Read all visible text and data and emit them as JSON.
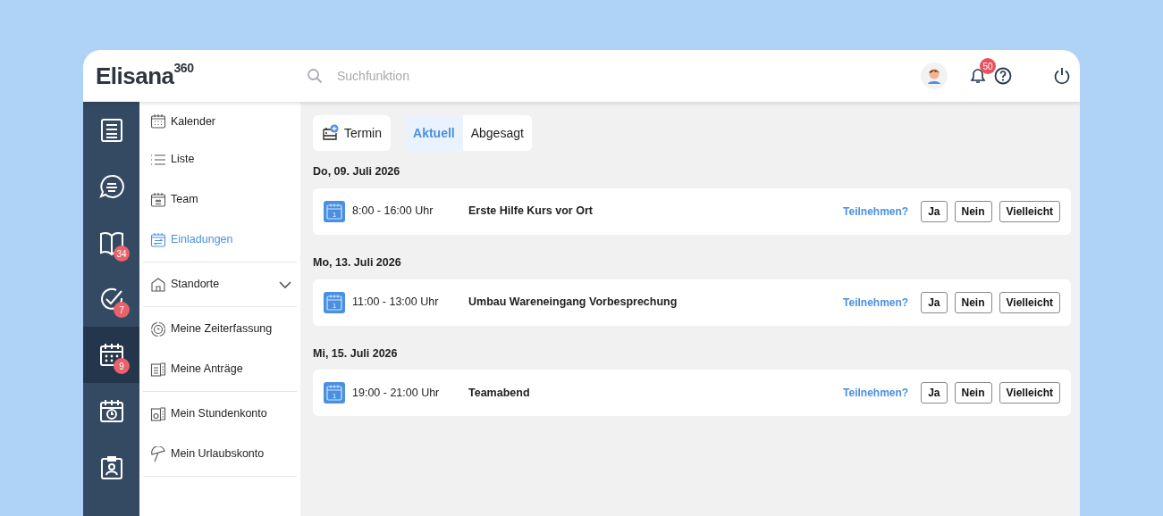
{
  "header": {
    "logo": "Elisana",
    "logo_sup": "360",
    "search": {
      "placeholder": "Suchfunktion"
    },
    "notifications_badge": "50"
  },
  "rail": [
    {
      "kind": "news",
      "selected": false
    },
    {
      "kind": "chat",
      "selected": false
    },
    {
      "kind": "book",
      "badge": "34",
      "selected": false
    },
    {
      "kind": "check",
      "badge": "7",
      "selected": false
    },
    {
      "kind": "calendar",
      "badge": "9",
      "selected": true
    },
    {
      "kind": "schedule",
      "selected": false
    },
    {
      "kind": "idcard",
      "selected": false
    }
  ],
  "submenu": [
    {
      "items": [
        {
          "kind": "calendar",
          "label": "Kalender",
          "selected": false
        },
        {
          "kind": "list",
          "label": "Liste",
          "selected": false
        },
        {
          "kind": "team",
          "label": "Team",
          "selected": false
        },
        {
          "kind": "invite",
          "label": "Einladungen",
          "selected": true
        }
      ]
    },
    {
      "items": [
        {
          "kind": "house",
          "label": "Standorte",
          "selected": false,
          "expanded": false
        }
      ]
    },
    {
      "items": [
        {
          "kind": "clock",
          "label": "Meine Zeiterfassung",
          "selected": false
        },
        {
          "kind": "docs",
          "label": "Meine Anträge",
          "selected": false
        }
      ]
    },
    {
      "items": [
        {
          "kind": "account",
          "label": "Mein Stundenkonto",
          "selected": false
        },
        {
          "kind": "umbrella",
          "label": "Mein Urlaubskonto",
          "selected": false
        }
      ]
    }
  ],
  "toolbar": {
    "new_button": "Termin",
    "tabs": [
      {
        "label": "Aktuell",
        "selected": true
      },
      {
        "label": "Abgesagt",
        "selected": false
      }
    ]
  },
  "days": [
    {
      "date": "Do, 09. Juli 2026",
      "events": [
        {
          "icon_day": "1",
          "time": "8:00 - 16:00 Uhr",
          "title": "Erste Hilfe Kurs vor Ort",
          "prompt": "Teilnehmen?",
          "answers": [
            "Ja",
            "Nein",
            "Vielleicht"
          ]
        }
      ]
    },
    {
      "date": "Mo, 13. Juli 2026",
      "events": [
        {
          "icon_day": "1",
          "time": "11:00 - 13:00 Uhr",
          "title": "Umbau Wareneingang Vorbesprechung",
          "prompt": "Teilnehmen?",
          "answers": [
            "Ja",
            "Nein",
            "Vielleicht"
          ]
        }
      ]
    },
    {
      "date": "Mi, 15. Juli 2026",
      "events": [
        {
          "icon_day": "1",
          "time": "19:00 - 21:00 Uhr",
          "title": "Teamabend",
          "prompt": "Teilnehmen?",
          "answers": [
            "Ja",
            "Nein",
            "Vielleicht"
          ]
        }
      ]
    }
  ]
}
